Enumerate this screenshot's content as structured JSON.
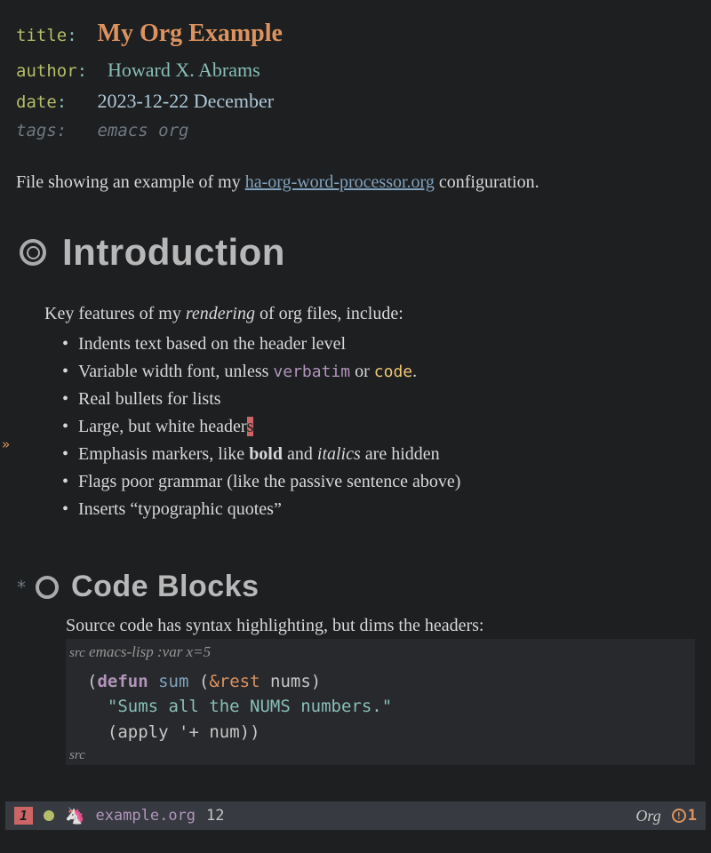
{
  "meta": {
    "title_key": "title",
    "title_val": "My Org Example",
    "author_key": "author",
    "author_val": "Howard X. Abrams",
    "date_key": "date",
    "date_val": "2023-12-22 December",
    "tags_key": "tags:",
    "tags_val": "emacs org"
  },
  "intro": {
    "pre": "File showing an example of my ",
    "link": "ha-org-word-processor.org",
    "post": " configuration."
  },
  "h1": "Introduction",
  "para1_pre": "Key features of my ",
  "para1_em": "rendering",
  "para1_post": " of org files, include:",
  "bullets": {
    "b0": "Indents text based on the header level",
    "b1_pre": "Variable width font, unless ",
    "b1_verbatim": "verbatim",
    "b1_mid": " or ",
    "b1_code": "code",
    "b1_post": ".",
    "b2": "Real bullets for lists",
    "b3_pre": "Large, but white header",
    "b3_cursor": "s",
    "b4_pre": "Emphasis markers, like ",
    "b4_bold": "bold",
    "b4_mid": " and ",
    "b4_ital": "italics",
    "b4_post": " are hidden",
    "b5": "Flags poor grammar (like the passive sentence above)",
    "b6": "Inserts “typographic quotes”"
  },
  "h2": "Code Blocks",
  "sub_para": "Source code has syntax highlighting, but dims the headers:",
  "src": {
    "label": "src",
    "lang": "emacs-lisp :var x=5",
    "end": "src"
  },
  "code": {
    "l1_kw": "defun",
    "l1_fn": "sum",
    "l1_amp": "&rest",
    "l1_arg": "nums",
    "l2_doc": "\"Sums all the NUMS numbers.\"",
    "l3_fn": "apply",
    "l3_sym": "'+",
    "l3_arg": "num"
  },
  "modeline": {
    "winnum": "1",
    "filename": "example.org",
    "line": "12",
    "mode": "Org",
    "warn_count": "1"
  }
}
